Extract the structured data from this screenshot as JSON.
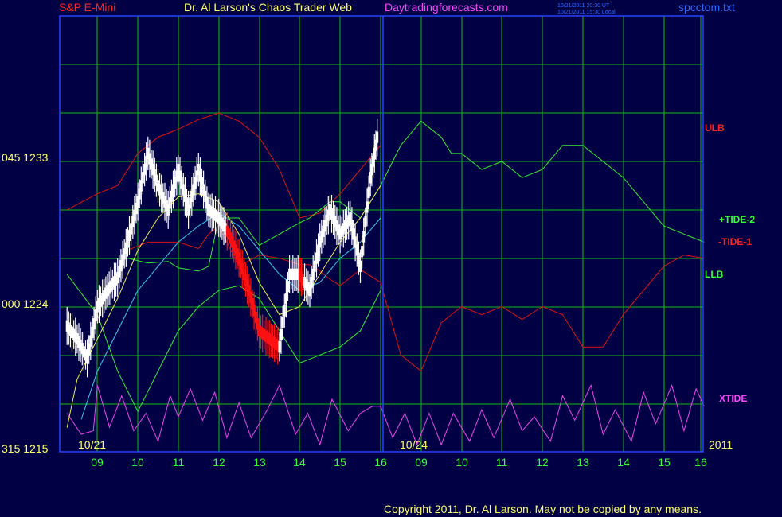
{
  "header": {
    "instrument": "S&P E-Mini",
    "title": "Dr. Al Larson's Chaos Trader Web",
    "site": "Daytradingforecasts.com",
    "stamp_ut": "10/21/2011 20:30 UT",
    "stamp_local": "10/21/2011 15:30 Local",
    "file": "spcctom.txt"
  },
  "colors": {
    "background": "#020044",
    "grid": "#11bb11",
    "axis": "#2244ff",
    "price": "#ffffff",
    "price_down": "#ff1111",
    "ulb_llb_upper": "#dd1111",
    "tide_plus": "#33ee33",
    "tide_minus": "#dd1111",
    "avg_cyan": "#33ccee",
    "avg_yellow": "#eeee44",
    "xtide": "#ee44ee"
  },
  "chart_data": {
    "type": "line",
    "title": "S&P E-Mini",
    "y_tick_labels": [
      "045 1233",
      "000 1224",
      "315 1215"
    ],
    "y_ticks": [
      1233,
      1224,
      1215
    ],
    "ylim": [
      1215,
      1237.5
    ],
    "x_tick_labels": [
      "09",
      "10",
      "11",
      "12",
      "13",
      "14",
      "15",
      "16",
      "09",
      "10",
      "11",
      "12",
      "13",
      "14",
      "15",
      "16"
    ],
    "date_labels": [
      "10/21",
      "10/24",
      "2011"
    ],
    "series_labels": [
      "ULB",
      "+TIDE-2",
      "-TIDE-1",
      "LLB",
      "XTIDE"
    ],
    "grid": true,
    "footer": "Copyright 2011, Dr. Al Larson. May not be copied by any means.",
    "price": {
      "x": [
        8.25,
        8.5,
        8.75,
        9.0,
        9.25,
        9.5,
        9.75,
        10.0,
        10.25,
        10.5,
        10.75,
        11.0,
        11.25,
        11.5,
        11.75,
        12.0,
        12.25,
        12.5,
        12.75,
        13.0,
        13.25,
        13.5,
        13.75,
        14.0,
        14.25,
        14.5,
        14.75,
        15.0,
        15.25,
        15.5,
        15.75,
        15.95
      ],
      "y": [
        1222.8,
        1222.0,
        1220.8,
        1224.0,
        1225.0,
        1225.8,
        1228.0,
        1230.5,
        1233.5,
        1231.5,
        1230.0,
        1232.5,
        1230.0,
        1232.5,
        1230.0,
        1229.5,
        1228.5,
        1227.0,
        1225.0,
        1222.5,
        1222.0,
        1221.5,
        1226.0,
        1226.0,
        1225.0,
        1228.0,
        1230.0,
        1228.5,
        1229.5,
        1226.5,
        1232.0,
        1235.0
      ]
    },
    "series": [
      {
        "name": "ULB",
        "x": [
          8.25,
          9.0,
          9.5,
          10.0,
          10.5,
          11.0,
          11.5,
          12.0,
          12.5,
          13.0,
          13.5,
          14.0,
          14.5,
          15.0,
          15.5,
          16.0
        ],
        "y": [
          1230.0,
          1231.0,
          1231.5,
          1233.5,
          1234.5,
          1235.0,
          1235.6,
          1236.0,
          1235.5,
          1234.5,
          1232.5,
          1229.5,
          1229.8,
          1231.0,
          1232.5,
          1234.0
        ]
      },
      {
        "name": "LLB",
        "x": [
          8.25,
          9.0,
          9.5,
          10.0,
          10.5,
          11.0,
          11.5,
          12.0,
          12.5,
          13.0,
          13.5,
          14.0,
          14.5,
          15.0,
          15.5,
          16.0
        ],
        "y": [
          1226.0,
          1223.5,
          1220.0,
          1217.5,
          1220.0,
          1222.5,
          1224.0,
          1225.0,
          1225.3,
          1224.5,
          1222.5,
          1220.5,
          1221.0,
          1221.5,
          1222.5,
          1225.0
        ]
      },
      {
        "name": "+TIDE-2",
        "x": [
          9.75,
          10.25,
          10.75,
          11.0,
          11.5,
          11.75,
          12.0,
          12.5,
          13.0,
          13.5,
          14.0,
          14.25,
          14.5,
          14.75,
          15.0,
          15.5,
          16.0,
          16.5,
          17.0,
          17.5,
          17.75,
          18.0,
          18.5,
          19.0,
          19.5,
          20.0,
          20.5,
          21.0,
          21.5,
          22.0,
          22.5,
          23.0,
          23.5,
          24.0
        ],
        "y": [
          1227.0,
          1226.7,
          1226.8,
          1226.4,
          1226.2,
          1226.5,
          1229.5,
          1229.5,
          1227.8,
          1228.5,
          1229.2,
          1229.5,
          1230.0,
          1230.5,
          1230.5,
          1229.5,
          1231.5,
          1234.0,
          1235.5,
          1234.5,
          1233.5,
          1233.5,
          1232.5,
          1233.0,
          1232.0,
          1232.5,
          1234.0,
          1234.0,
          1233.0,
          1232.0,
          1230.5,
          1229.0,
          1228.5,
          1228.0
        ]
      },
      {
        "name": "-TIDE-1",
        "x": [
          9.75,
          10.25,
          10.75,
          11.0,
          11.5,
          11.75,
          12.0,
          12.5,
          13.0,
          13.5,
          14.0,
          14.25,
          14.5,
          14.75,
          15.0,
          15.5,
          16.0,
          16.5,
          17.0,
          17.5,
          17.75,
          18.0,
          18.5,
          19.0,
          19.5,
          20.0,
          20.5,
          21.0,
          21.5,
          22.0,
          22.5,
          23.0,
          23.5,
          24.0
        ],
        "y": [
          1227.5,
          1228.0,
          1228.0,
          1228.0,
          1227.6,
          1228.5,
          1229.0,
          1226.5,
          1227.2,
          1227.0,
          1226.6,
          1226.6,
          1226.2,
          1225.7,
          1225.3,
          1226.3,
          1225.5,
          1221.0,
          1220.0,
          1223.0,
          1223.5,
          1224.0,
          1223.5,
          1224.0,
          1223.2,
          1224.0,
          1223.5,
          1221.5,
          1221.5,
          1223.5,
          1225.0,
          1226.5,
          1227.2,
          1227.0
        ]
      },
      {
        "name": "cyan average",
        "x": [
          8.6,
          9.0,
          9.5,
          10.0,
          10.5,
          11.0,
          11.5,
          12.0,
          12.5,
          13.0,
          13.5,
          14.0,
          14.5,
          15.0,
          15.5,
          16.0
        ],
        "y": [
          1217.0,
          1220.0,
          1222.5,
          1225.0,
          1226.5,
          1228.0,
          1229.0,
          1229.8,
          1229.0,
          1227.5,
          1226.0,
          1225.0,
          1225.5,
          1227.0,
          1228.0,
          1229.5
        ]
      },
      {
        "name": "yellow average",
        "x": [
          8.25,
          8.5,
          9.0,
          9.5,
          10.0,
          10.5,
          11.0,
          11.5,
          12.0,
          12.5,
          13.0,
          13.5,
          14.0,
          14.5,
          15.0,
          15.5,
          16.0
        ],
        "y": [
          1216.5,
          1219.5,
          1222.0,
          1224.5,
          1227.5,
          1229.5,
          1230.8,
          1231.0,
          1230.5,
          1228.5,
          1225.5,
          1223.5,
          1224.0,
          1226.0,
          1228.0,
          1229.5,
          1231.5
        ]
      }
    ],
    "xtide": {
      "x": [
        8.25,
        8.6,
        8.9,
        9.0,
        9.3,
        9.6,
        9.9,
        10.2,
        10.5,
        10.8,
        11.0,
        11.3,
        11.6,
        11.9,
        12.2,
        12.5,
        12.8,
        13.2,
        13.5,
        13.9,
        14.2,
        14.5,
        14.8,
        15.2,
        15.5,
        15.8,
        16.0,
        16.3,
        16.6,
        16.9,
        17.2,
        17.5,
        17.8,
        18.2,
        18.5,
        18.8,
        19.2,
        19.5,
        19.8,
        20.2,
        20.5,
        20.8,
        21.2,
        21.5,
        21.8,
        22.2,
        22.5,
        22.8,
        23.2,
        23.5,
        23.8,
        24.0
      ],
      "y": [
        0.55,
        0.25,
        0.3,
        0.95,
        0.35,
        0.8,
        0.3,
        0.55,
        0.15,
        0.8,
        0.5,
        0.9,
        0.45,
        0.85,
        0.2,
        0.7,
        0.2,
        0.6,
        0.95,
        0.25,
        0.55,
        0.1,
        0.75,
        0.3,
        0.55,
        0.65,
        0.65,
        0.2,
        0.55,
        0.1,
        0.55,
        0.1,
        0.55,
        0.15,
        0.6,
        0.2,
        0.75,
        0.3,
        0.5,
        0.15,
        0.8,
        0.45,
        0.95,
        0.25,
        0.6,
        0.15,
        0.85,
        0.4,
        0.95,
        0.3,
        0.9,
        0.65
      ]
    }
  }
}
